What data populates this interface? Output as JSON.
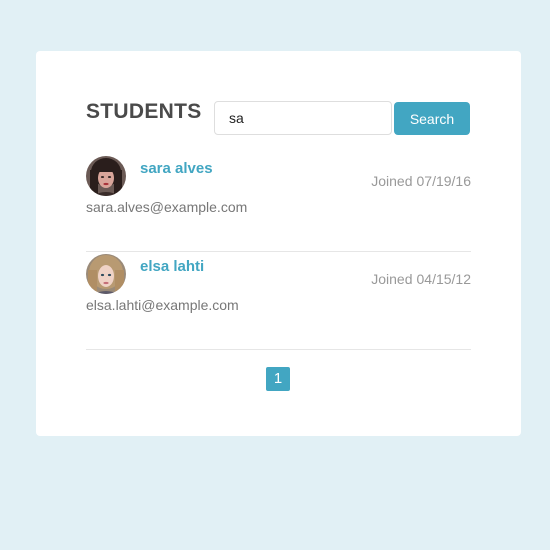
{
  "header": {
    "title": "STUDENTS"
  },
  "search": {
    "value": "sa",
    "placeholder": "",
    "button_label": "Search"
  },
  "students": [
    {
      "name": "sara alves",
      "email": "sara.alves@example.com",
      "joined_label": "Joined",
      "joined_date": "07/19/16",
      "avatar": "avatar-photo-dark-hair"
    },
    {
      "name": "elsa lahti",
      "email": "elsa.lahti@example.com",
      "joined_label": "Joined",
      "joined_date": "04/15/12",
      "avatar": "avatar-photo-light-hair"
    }
  ],
  "pagination": {
    "pages": [
      "1"
    ],
    "current": "1"
  },
  "colors": {
    "background": "#e1f0f5",
    "accent": "#42a6c2",
    "title": "#4a4a4a",
    "muted": "#999999"
  }
}
